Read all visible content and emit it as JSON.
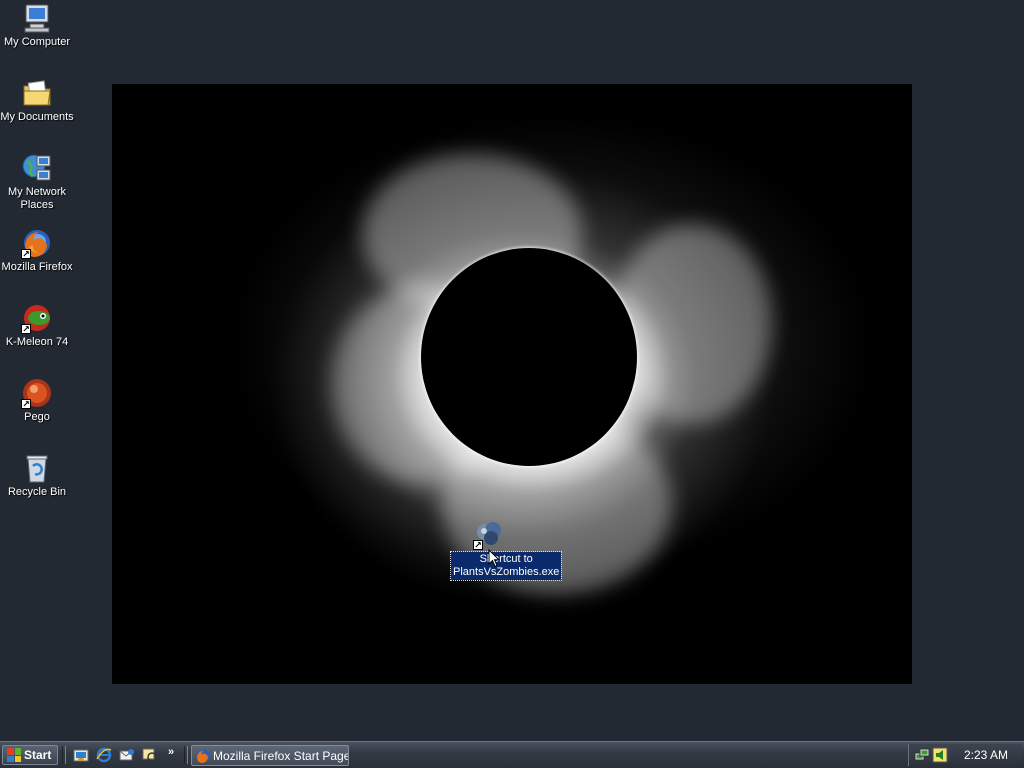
{
  "desktop": {
    "icons": [
      {
        "label": "My Computer",
        "icon": "computer-icon"
      },
      {
        "label": "My Documents",
        "icon": "folder-icon"
      },
      {
        "label": "My Network Places",
        "icon": "network-icon"
      },
      {
        "label": "Mozilla Firefox",
        "icon": "firefox-icon",
        "shortcut": true
      },
      {
        "label": "K-Meleon 74",
        "icon": "kmeleon-icon",
        "shortcut": true
      },
      {
        "label": "Pego",
        "icon": "pego-icon",
        "shortcut": true
      },
      {
        "label": "Recycle Bin",
        "icon": "recycle-bin-icon"
      }
    ],
    "selected_icon": {
      "label": "Shortcut to PlantsVsZombies.exe",
      "icon": "plants-vs-zombies-icon",
      "shortcut": true
    },
    "wallpaper": "solar-eclipse"
  },
  "taskbar": {
    "start_label": "Start",
    "quick_launch": [
      "show-desktop-icon",
      "internet-explorer-icon",
      "outlook-express-icon",
      "windows-media-icon"
    ],
    "chevron": "»",
    "tasks": [
      {
        "label": "Mozilla Firefox Start Page...",
        "icon": "firefox-icon"
      }
    ],
    "tray": {
      "icons": [
        "network-tray-icon",
        "volume-tray-icon"
      ],
      "time": "2:23 AM"
    }
  },
  "colors": {
    "desktop_bg": "#222932",
    "selection": "#0b2a6b"
  }
}
